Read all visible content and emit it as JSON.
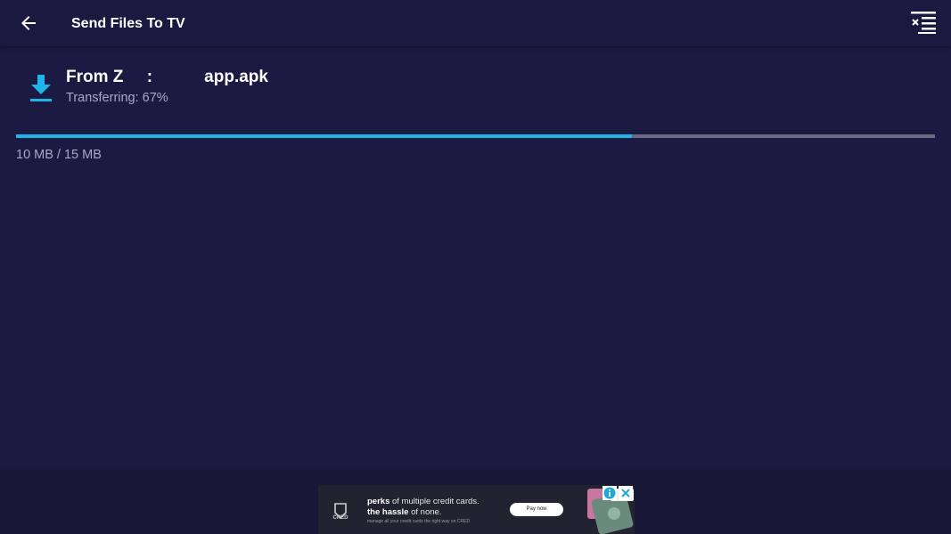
{
  "header": {
    "title": "Send Files To TV",
    "back_icon": "arrow-left-icon",
    "clear_icon": "clear-list-icon"
  },
  "transfer": {
    "icon": "download-icon",
    "file_name": "From Z     :           app.apk",
    "status": "Transferring: 67%",
    "progress": 0.67,
    "size_text": "10 MB / 15 MB"
  },
  "ad": {
    "brand": "CRED",
    "headline_1_bold": "perks",
    "headline_1_rest": " of multiple credit cards.",
    "headline_2_bold": "the hassle",
    "headline_2_rest": " of none.",
    "subtext": "manage all your credit cards the right way on CRED",
    "cta": "Pay now"
  },
  "colors": {
    "background": "#1b1a42",
    "accent": "#1eb6ea",
    "track": "#6c6a82",
    "secondary_text": "#a9a9c4"
  }
}
